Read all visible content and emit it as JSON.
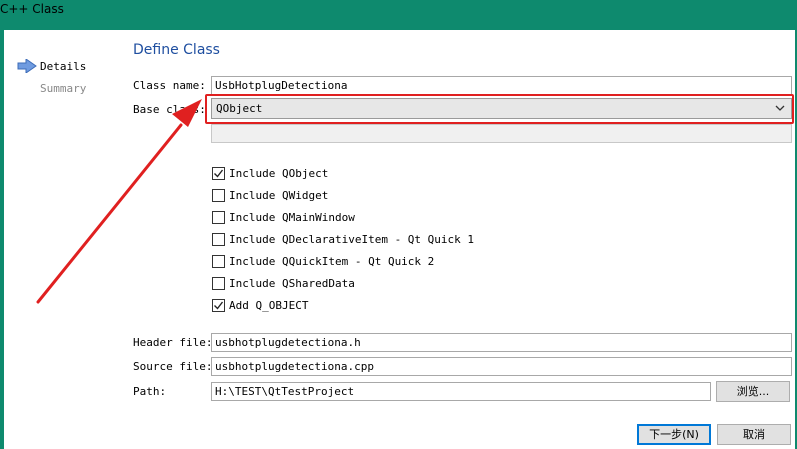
{
  "window": {
    "title": "C++ Class"
  },
  "nav": {
    "items": [
      {
        "label": "Details"
      },
      {
        "label": "Summary"
      }
    ]
  },
  "page": {
    "heading": "Define Class"
  },
  "form": {
    "class_name_label": "Class name:",
    "class_name_value": "UsbHotplugDetectiona",
    "base_class_label": "Base class:",
    "base_class_value": "QObject",
    "header_file_label": "Header file:",
    "header_file_value": "usbhotplugdetectiona.h",
    "source_file_label": "Source file:",
    "source_file_value": "usbhotplugdetectiona.cpp",
    "path_label": "Path:",
    "path_value": "H:\\TEST\\QtTestProject",
    "browse_label": "浏览..."
  },
  "checkboxes": [
    {
      "label": "Include QObject",
      "checked": true
    },
    {
      "label": "Include QWidget",
      "checked": false
    },
    {
      "label": "Include QMainWindow",
      "checked": false
    },
    {
      "label": "Include QDeclarativeItem - Qt Quick 1",
      "checked": false
    },
    {
      "label": "Include QQuickItem - Qt Quick 2",
      "checked": false
    },
    {
      "label": "Include QSharedData",
      "checked": false
    },
    {
      "label": "Add Q_OBJECT",
      "checked": true
    }
  ],
  "buttons": {
    "next_label": "下一步(N)",
    "cancel_label": "取消"
  },
  "colors": {
    "titlebar": "#0e8a6e",
    "heading": "#1f4fa0",
    "annotation": "#e02020"
  }
}
